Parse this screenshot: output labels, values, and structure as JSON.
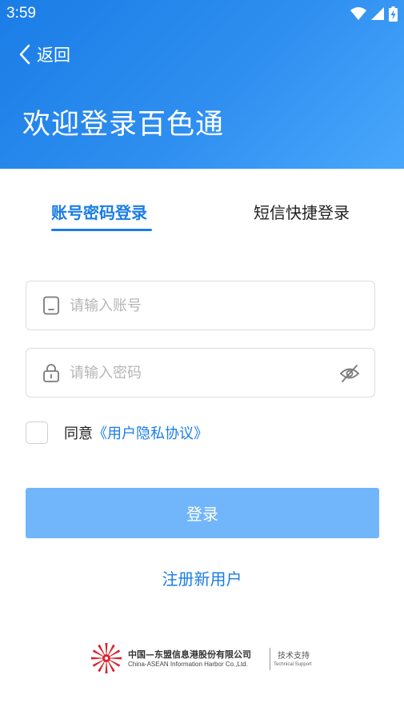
{
  "status_bar": {
    "time": "3:59",
    "icons": [
      "wifi-icon",
      "cell-signal-icon",
      "battery-charging-icon"
    ]
  },
  "header": {
    "back_label": "返回",
    "welcome": "欢迎登录百色通",
    "colors": {
      "gradient_start": "#1a7de6",
      "gradient_end": "#49a7fb"
    }
  },
  "tabs": {
    "account": "账号密码登录",
    "sms": "短信快捷登录",
    "active": "account"
  },
  "form": {
    "account_placeholder": "请输入账号",
    "account_value": "",
    "password_placeholder": "请输入密码",
    "password_value": "",
    "account_icon": "phone-icon",
    "password_icon": "lock-icon",
    "visibility_icon": "eye-off-icon"
  },
  "agreement": {
    "prefix": "同意",
    "link": "《用户隐私协议》",
    "checked": false
  },
  "actions": {
    "login": "登录",
    "register": "注册新用户",
    "login_color": "#71b6fb",
    "accent_color": "#1a7de6"
  },
  "footer": {
    "company_cn": "中国—东盟信息港股份有限公司",
    "company_en": "China-ASEAN Information Harbor Co.,Ltd.",
    "support_cn": "技术支持",
    "support_en": "Technical Support"
  }
}
